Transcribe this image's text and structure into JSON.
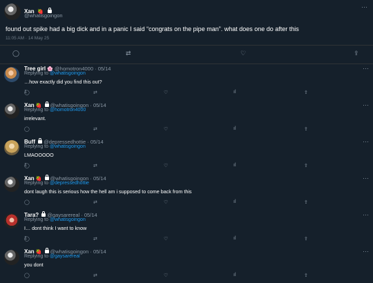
{
  "main": {
    "author_name": "Xan",
    "author_emoji": "🍓",
    "author_handle": "@whatisgoingon",
    "text": "found out spike had a big dick and in a panic I said “congrats on the pipe man”. what does one do after this",
    "timestamp": "11:05 AM · 14 May 25",
    "more": "···",
    "actions": {
      "reply": "◯",
      "retweet": "⇄",
      "like": "♡",
      "share": "⇪"
    }
  },
  "replies": [
    {
      "name": "Tree girl",
      "emoji": "🌸",
      "handle": "@homotron4000",
      "date": "05/14",
      "replying_label": "Replying to",
      "replying_to": "@whatisgoingon",
      "text": "…how exactly did you find this out?",
      "reply_count": "1",
      "avatar": "tree"
    },
    {
      "name": "Xan",
      "emoji": "🍓",
      "handle": "@whatisgoingon",
      "date": "05/14",
      "replying_label": "Replying to",
      "replying_to": "@homotron4000",
      "text": "irrelevant.",
      "reply_count": "",
      "avatar": "xan"
    },
    {
      "name": "Buff",
      "emoji": "",
      "handle": "@depressedhottie",
      "date": "05/14",
      "replying_label": "Replying to",
      "replying_to": "@whatisgoingon",
      "text": "LMAOOOOO",
      "reply_count": "1",
      "avatar": "blonde"
    },
    {
      "name": "Xan",
      "emoji": "🍓",
      "handle": "@whatisgoingon",
      "date": "05/14",
      "replying_label": "Replying to",
      "replying_to": "@depressedhottie",
      "text": "dont laugh this is serious how the hell am i supposed to come back from this",
      "reply_count": "",
      "avatar": "xan"
    },
    {
      "name": "Tara?",
      "emoji": "",
      "handle": "@gaysarereal",
      "date": "05/14",
      "replying_label": "Replying to",
      "replying_to": "@whatisgoingon",
      "text": "I… dont think I want to know",
      "reply_count": "1",
      "avatar": "red"
    },
    {
      "name": "Xan",
      "emoji": "🍓",
      "handle": "@whatisgoingon",
      "date": "05/14",
      "replying_label": "Replying to",
      "replying_to": "@gaysarereal",
      "text": "you dont",
      "reply_count": "",
      "avatar": "xan"
    }
  ],
  "reply_actions": {
    "reply": "◯",
    "retweet": "⇄",
    "like": "♡",
    "stats": "ıl",
    "share": "⇪"
  }
}
